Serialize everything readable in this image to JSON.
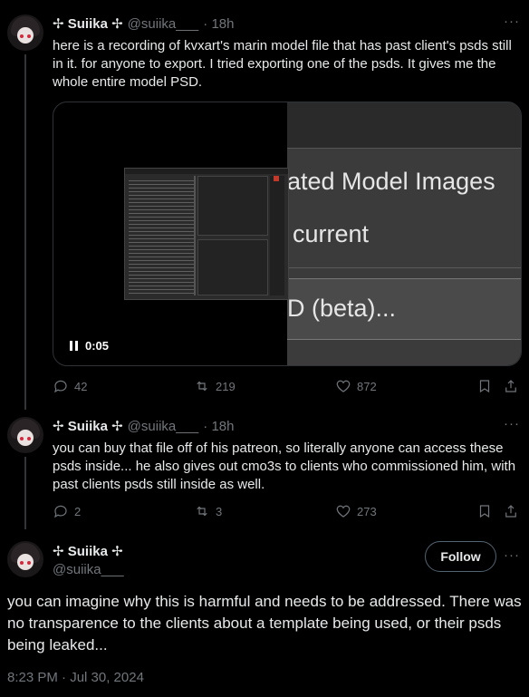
{
  "tweets": [
    {
      "name": "✢ Suiika ✢",
      "handle": "@suiika___",
      "time": "· 18h",
      "text": "here is a recording of kvxart's marin model file that has past client's psds still in it. for anyone to export.  I tried exporting one of the psds. It gives me the whole entire model PSD.",
      "video": {
        "duration": "0:05",
        "zoom_lines": [
          "ated Model Images",
          "current",
          "D (beta)..."
        ]
      },
      "stats": {
        "replies": "42",
        "reposts": "219",
        "likes": "872"
      }
    },
    {
      "name": "✢ Suiika ✢",
      "handle": "@suiika___",
      "time": "· 18h",
      "text": "you can buy that file off of his patreon, so literally anyone can access these psds inside... he also gives out cmo3s to clients who commissioned him, with past clients psds still inside as well.",
      "stats": {
        "replies": "2",
        "reposts": "3",
        "likes": "273"
      }
    }
  ],
  "main": {
    "name": "✢ Suiika ✢",
    "handle": "@suiika___",
    "follow_label": "Follow",
    "text": "you can imagine why this is harmful and needs to be addressed. There was no transparence to the clients about a template being used, or their psds being leaked...",
    "timestamp": "8:23 PM · Jul 30, 2024"
  },
  "more_label": "···",
  "colors": {
    "background": "#000000",
    "text": "#e7e9ea",
    "muted": "#71767b",
    "border": "#2f3336"
  }
}
